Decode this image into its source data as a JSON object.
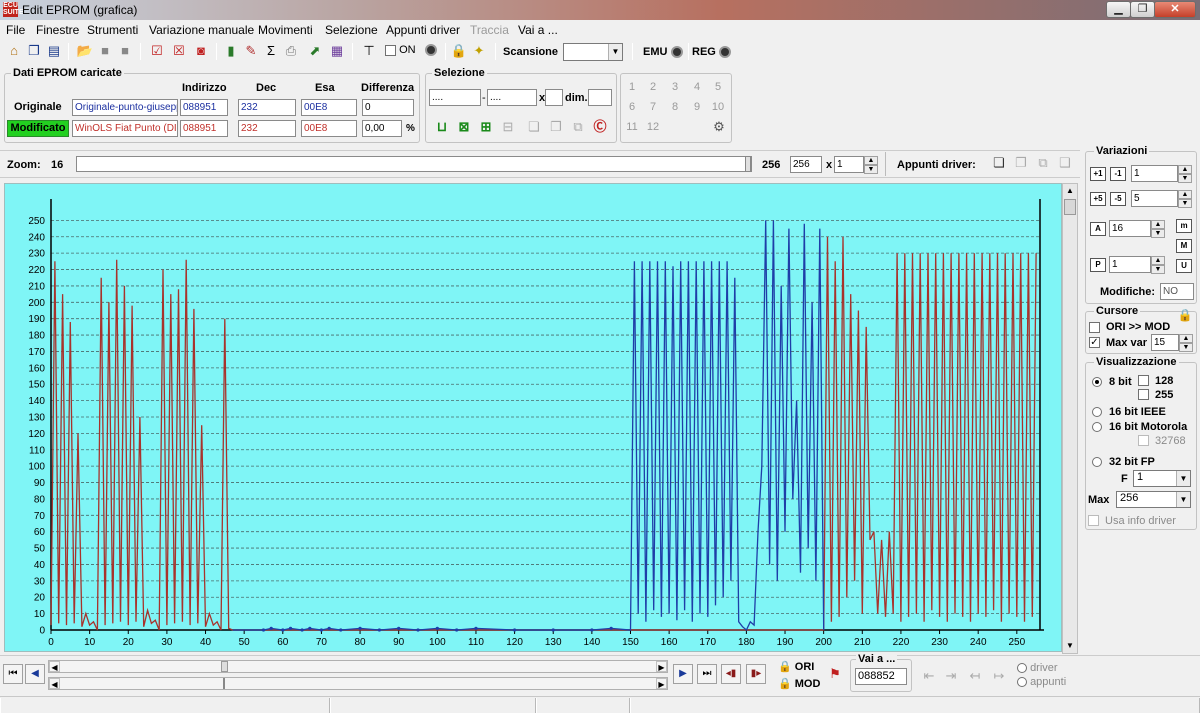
{
  "window": {
    "title": "Edit EPROM (grafica)",
    "app_icon_text": "ECU SUITE",
    "minimize": "▁",
    "maximize": "❐",
    "close": "✕"
  },
  "menu": [
    "File",
    "Finestre",
    "Strumenti",
    "Variazione manuale",
    "Movimenti",
    "Selezione",
    "Appunti driver",
    "Traccia",
    "Vai a ..."
  ],
  "toolbar": {
    "on_label": "ON",
    "scansione_label": "Scansione",
    "scansione_value": "",
    "emu_label": "EMU",
    "reg_label": "REG"
  },
  "dati": {
    "title": "Dati EPROM caricate",
    "headers": {
      "indirizzo": "Indirizzo",
      "dec": "Dec",
      "esa": "Esa",
      "differenza": "Differenza"
    },
    "originale": {
      "label": "Originale",
      "file": "Originale-punto-giusepp",
      "indirizzo": "088951",
      "dec": "232",
      "esa": "00E8",
      "diff": "0"
    },
    "modificato": {
      "label": "Modificato",
      "file": "WinOLS Fiat Punto (DI",
      "indirizzo": "088951",
      "dec": "232",
      "esa": "00E8",
      "diff": "0,00",
      "diff_unit": "%"
    }
  },
  "selezione": {
    "title": "Selezione",
    "from": "....",
    "to": "....",
    "x_label": "x",
    "dim_label": "dim.",
    "dim_value": ""
  },
  "numpad": [
    "1",
    "2",
    "3",
    "4",
    "5",
    "6",
    "7",
    "8",
    "9",
    "10",
    "11",
    "12"
  ],
  "zoom": {
    "label": "Zoom:",
    "min": "16",
    "max": "256",
    "value": "256",
    "x_label": "x",
    "mult": "1"
  },
  "appunti": {
    "label": "Appunti driver:"
  },
  "variazioni": {
    "title": "Variazioni",
    "v1": "1",
    "v2": "5",
    "v3": "16",
    "v4": "1",
    "modifiche_label": "Modifiche:",
    "modifiche_value": "NO",
    "btn_m": "m",
    "btn_M": "M",
    "btn_U": "U"
  },
  "cursore": {
    "title": "Cursore",
    "ori_mod": "ORI >> MOD",
    "max_var": "Max var",
    "max_var_value": "15",
    "max_var_checked": "✓"
  },
  "visualizzazione": {
    "title": "Visualizzazione",
    "opt_8bit": "8 bit",
    "opt_128": "128",
    "opt_255": "255",
    "opt_16ieee": "16 bit IEEE",
    "opt_16moto": "16 bit Motorola",
    "opt_32768": "32768",
    "opt_32fp": "32 bit FP",
    "f_label": "F",
    "f_value": "1",
    "max_label": "Max",
    "max_value": "256",
    "usa_info": "Usa info driver"
  },
  "bottom": {
    "ori_label": "ORI",
    "mod_label": "MOD",
    "vai_label": "Vai a ...",
    "vai_value": "088852",
    "driver_label": "driver",
    "appunti_label": "appunti"
  },
  "chart_data": {
    "type": "line",
    "xlim": [
      0,
      256
    ],
    "ylim": [
      0,
      260
    ],
    "x_ticks": [
      0,
      10,
      20,
      30,
      40,
      50,
      60,
      70,
      80,
      90,
      100,
      110,
      120,
      130,
      140,
      150,
      160,
      170,
      180,
      190,
      200,
      210,
      220,
      230,
      240,
      250
    ],
    "y_ticks": [
      0,
      10,
      20,
      30,
      40,
      50,
      60,
      70,
      80,
      90,
      100,
      110,
      120,
      130,
      140,
      150,
      160,
      170,
      180,
      190,
      200,
      210,
      220,
      230,
      240,
      250
    ],
    "grid": "horizontal dashed",
    "series": [
      {
        "color": "#a8332c",
        "points": [
          [
            0,
            3
          ],
          [
            1,
            225
          ],
          [
            2,
            4
          ],
          [
            3,
            205
          ],
          [
            4,
            3
          ],
          [
            5,
            188
          ],
          [
            6,
            4
          ],
          [
            7,
            120
          ],
          [
            8,
            2
          ],
          [
            9,
            10
          ],
          [
            10,
            3
          ],
          [
            11,
            5
          ],
          [
            12,
            0
          ],
          [
            13,
            215
          ],
          [
            14,
            3
          ],
          [
            15,
            200
          ],
          [
            16,
            4
          ],
          [
            17,
            226
          ],
          [
            18,
            5
          ],
          [
            19,
            210
          ],
          [
            20,
            3
          ],
          [
            21,
            198
          ],
          [
            22,
            5
          ],
          [
            23,
            130
          ],
          [
            24,
            2
          ],
          [
            25,
            12
          ],
          [
            26,
            4
          ],
          [
            27,
            6
          ],
          [
            28,
            0
          ],
          [
            29,
            220
          ],
          [
            30,
            3
          ],
          [
            31,
            205
          ],
          [
            32,
            4
          ],
          [
            33,
            208
          ],
          [
            34,
            5
          ],
          [
            35,
            226
          ],
          [
            36,
            3
          ],
          [
            37,
            196
          ],
          [
            38,
            4
          ],
          [
            39,
            125
          ],
          [
            40,
            2
          ],
          [
            41,
            10
          ],
          [
            42,
            3
          ],
          [
            43,
            5
          ],
          [
            44,
            0
          ],
          [
            45,
            190
          ],
          [
            46,
            1
          ],
          [
            47,
            0
          ],
          [
            150,
            0
          ],
          [
            200,
            0
          ],
          [
            201,
            240
          ],
          [
            202,
            5
          ],
          [
            203,
            225
          ],
          [
            204,
            8
          ],
          [
            205,
            240
          ],
          [
            206,
            20
          ],
          [
            207,
            205
          ],
          [
            208,
            30
          ],
          [
            209,
            195
          ],
          [
            210,
            10
          ],
          [
            211,
            185
          ],
          [
            212,
            55
          ],
          [
            213,
            60
          ],
          [
            214,
            10
          ],
          [
            215,
            55
          ],
          [
            216,
            8
          ],
          [
            217,
            60
          ],
          [
            218,
            10
          ],
          [
            219,
            230
          ],
          [
            220,
            5
          ],
          [
            221,
            230
          ],
          [
            222,
            8
          ],
          [
            223,
            230
          ],
          [
            224,
            10
          ],
          [
            225,
            230
          ],
          [
            226,
            5
          ],
          [
            227,
            230
          ],
          [
            228,
            12
          ],
          [
            229,
            230
          ],
          [
            230,
            8
          ],
          [
            231,
            230
          ],
          [
            232,
            5
          ],
          [
            233,
            230
          ],
          [
            234,
            10
          ],
          [
            235,
            230
          ],
          [
            236,
            8
          ],
          [
            237,
            230
          ],
          [
            238,
            5
          ],
          [
            239,
            230
          ],
          [
            240,
            10
          ],
          [
            241,
            230
          ],
          [
            242,
            8
          ],
          [
            243,
            230
          ],
          [
            244,
            12
          ],
          [
            245,
            230
          ],
          [
            246,
            5
          ],
          [
            247,
            230
          ],
          [
            248,
            10
          ],
          [
            249,
            230
          ],
          [
            250,
            8
          ],
          [
            251,
            230
          ],
          [
            252,
            5
          ],
          [
            253,
            230
          ],
          [
            254,
            8
          ],
          [
            255,
            230
          ]
        ]
      },
      {
        "color": "#1e3ea8",
        "points": [
          [
            47,
            0
          ],
          [
            55,
            0
          ],
          [
            57,
            1
          ],
          [
            60,
            0
          ],
          [
            62,
            1
          ],
          [
            65,
            0
          ],
          [
            67,
            1
          ],
          [
            70,
            0
          ],
          [
            72,
            1
          ],
          [
            75,
            0
          ],
          [
            80,
            1
          ],
          [
            85,
            0
          ],
          [
            90,
            1
          ],
          [
            95,
            0
          ],
          [
            100,
            1
          ],
          [
            105,
            0
          ],
          [
            110,
            1
          ],
          [
            120,
            0
          ],
          [
            130,
            0
          ],
          [
            140,
            0
          ],
          [
            145,
            1
          ],
          [
            150,
            0
          ],
          [
            151,
            225
          ],
          [
            152,
            10
          ],
          [
            153,
            225
          ],
          [
            154,
            5
          ],
          [
            155,
            225
          ],
          [
            156,
            12
          ],
          [
            157,
            225
          ],
          [
            158,
            8
          ],
          [
            159,
            225
          ],
          [
            160,
            10
          ],
          [
            161,
            222
          ],
          [
            162,
            6
          ],
          [
            163,
            225
          ],
          [
            164,
            12
          ],
          [
            165,
            225
          ],
          [
            166,
            5
          ],
          [
            167,
            225
          ],
          [
            168,
            10
          ],
          [
            169,
            225
          ],
          [
            170,
            8
          ],
          [
            171,
            225
          ],
          [
            172,
            15
          ],
          [
            173,
            225
          ],
          [
            174,
            20
          ],
          [
            175,
            225
          ],
          [
            176,
            30
          ],
          [
            177,
            215
          ],
          [
            178,
            5
          ],
          [
            179,
            2
          ],
          [
            180,
            0
          ],
          [
            181,
            5
          ],
          [
            182,
            3
          ],
          [
            183,
            60
          ],
          [
            184,
            100
          ],
          [
            185,
            250
          ],
          [
            186,
            40
          ],
          [
            187,
            250
          ],
          [
            188,
            30
          ],
          [
            189,
            210
          ],
          [
            190,
            60
          ],
          [
            191,
            245
          ],
          [
            192,
            80
          ],
          [
            193,
            140
          ],
          [
            194,
            35
          ],
          [
            195,
            248
          ],
          [
            196,
            50
          ],
          [
            197,
            200
          ],
          [
            198,
            30
          ],
          [
            199,
            245
          ],
          [
            200,
            0
          ]
        ]
      }
    ]
  }
}
